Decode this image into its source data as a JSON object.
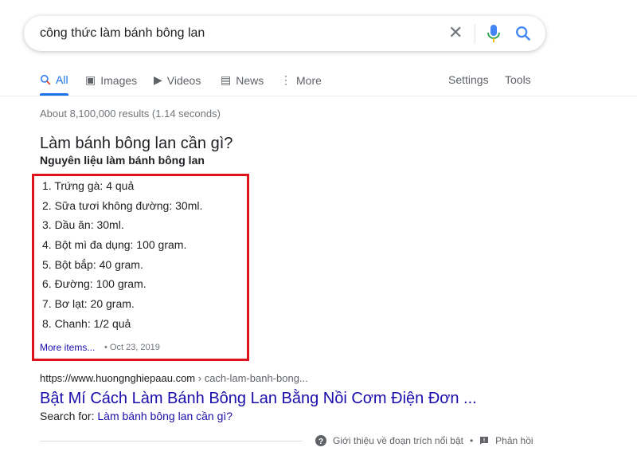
{
  "search": {
    "query": "công thức làm bánh bông lan"
  },
  "tabs": [
    {
      "label": "All",
      "icon": "search-icon"
    },
    {
      "label": "Images",
      "icon": "image-icon"
    },
    {
      "label": "Videos",
      "icon": "video-icon"
    },
    {
      "label": "News",
      "icon": "news-icon"
    },
    {
      "label": "More",
      "icon": "more-vert-icon"
    }
  ],
  "tools": {
    "settings": "Settings",
    "tools": "Tools"
  },
  "stats": "About 8,100,000 results (1.14 seconds)",
  "snippet": {
    "question": "Làm bánh bông lan cần gì?",
    "subtitle": "Nguyên liệu làm bánh bông lan",
    "items": [
      "1. Trứng gà: 4 quả",
      "2. Sữa tươi không đường: 30ml.",
      "3. Dầu ăn: 30ml.",
      "4. Bột mì đa dụng: 100 gram.",
      "5. Bột bắp: 40 gram.",
      "6. Đường: 100 gram.",
      "7. Bơ lạt: 20 gram.",
      "8. Chanh: 1/2 quả"
    ],
    "more": "More items...",
    "date": "• Oct 23, 2019",
    "highlight_color": "#e0121b"
  },
  "result": {
    "url": "https://www.huongnghiepaau.com",
    "path": " › cach-lam-banh-bong...",
    "title": "Bật Mí Cách Làm Bánh Bông Lan Bằng Nồi Cơm Điện Đơn ...",
    "search_for_label": "Search for: ",
    "search_for_link": "Làm bánh bông lan cần gì?"
  },
  "footer": {
    "about": "Giới thiệu về đoạn trích nổi bật",
    "dot": "•",
    "feedback": "Phản hồi"
  }
}
